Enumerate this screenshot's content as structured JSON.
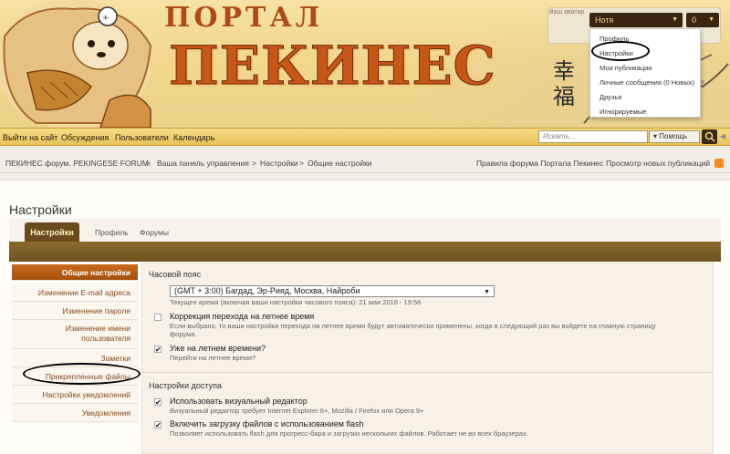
{
  "banner": {
    "logo_small": "ПОРТАЛ",
    "logo_big": "ПЕКИНЕС",
    "hanzi": "幸福",
    "avatar_alt": "Ваш аватар",
    "username": "Нотя",
    "counter": "0"
  },
  "user_menu": {
    "items": [
      "Профиль",
      "Настройки",
      "Мои публикации",
      "Личные сообщения (0 Новых)",
      "Друзья",
      "Игнорируемые"
    ]
  },
  "nav": {
    "items": [
      "Выйти на сайт",
      "Обсуждения",
      "Пользователи",
      "Календарь"
    ],
    "search_placeholder": "Искать...",
    "search_options": "Помощь"
  },
  "breadcrumb": {
    "items": [
      "ПЕКИНЕС форум. PEKINGESE FORUM.",
      "Ваша панель управления",
      "Настройки",
      "Общие настройки"
    ],
    "right_links": [
      "Правила форума Портала Пекинес",
      "Просмотр новых публикаций"
    ]
  },
  "page": {
    "title": "Настройки",
    "tabs": [
      "Настройки",
      "Профиль",
      "Форумы"
    ]
  },
  "side_menu": {
    "items": [
      "Общие настройки",
      "Изменение E-mail адреса",
      "Изменение пароля",
      "Изменение имени",
      "пользователя",
      "Заметки",
      "Прикрепленные файлы",
      "Настройки уведомлений",
      "Уведомления"
    ]
  },
  "form": {
    "timezone": {
      "title": "Часовой пояс",
      "selected": "(GMT + 3:00) Багдад, Эр-Рияд, Москва, Найроби",
      "hint": "Текущее время (включая ваши настройки часового пояса): 21 мая 2018 - 19:56",
      "dst_label": "Коррекция перехода на летнее время",
      "dst_hint1": "Если выбрано, то ваши настройки перехода на летнее время будут автоматически применены, когда в следующий раз вы войдете на главную страницу",
      "dst_hint2": "форума.",
      "dst_checked": false,
      "summer_label": "Уже на летнем времени?",
      "summer_hint": "Перейти на летнее время?",
      "summer_checked": true
    },
    "access": {
      "title": "Настройки доступа",
      "visual_label": "Использовать визуальный редактор",
      "visual_hint": "Визуальный редактор требует Internet Explorer 6+, Mozilla / Firefox или Opera 9+",
      "visual_checked": true,
      "flash_label": "Включить загрузку файлов с использованием flash",
      "flash_hint": "Позволяет использовать flash для прогресс-бара и загрузки нескольких файлов. Работает не во всех браузерах.",
      "flash_checked": true
    },
    "check_mark": "✔"
  },
  "colors": {
    "accent_brown": "#6b4b1e",
    "active_orange": "#c96a1b",
    "link_brown": "#8a4b1d",
    "nav_gold": "#e9c35a"
  }
}
